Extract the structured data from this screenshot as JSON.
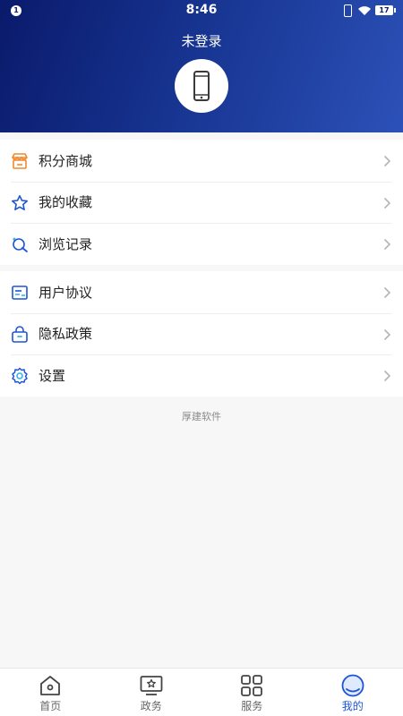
{
  "status_bar": {
    "notification_count": "1",
    "time": "8:46",
    "battery": "17"
  },
  "header": {
    "login_status": "未登录",
    "avatar_icon": "phone-icon"
  },
  "menu_groups": [
    {
      "items": [
        {
          "label": "积分商城",
          "icon": "store-icon",
          "icon_color": "#f08a2e"
        },
        {
          "label": "我的收藏",
          "icon": "star-icon",
          "icon_color": "#1d55d3"
        },
        {
          "label": "浏览记录",
          "icon": "history-icon",
          "icon_color": "#1d55d3"
        }
      ]
    },
    {
      "items": [
        {
          "label": "用户协议",
          "icon": "agreement-icon",
          "icon_color": "#1d55d3"
        },
        {
          "label": "隐私政策",
          "icon": "lock-bag-icon",
          "icon_color": "#1d55d3"
        },
        {
          "label": "设置",
          "icon": "gear-icon",
          "icon_color": "#1d55d3"
        }
      ]
    }
  ],
  "brand_footer": "厚建软件",
  "tabs": [
    {
      "label": "首页",
      "icon": "home-icon",
      "active": false
    },
    {
      "label": "政务",
      "icon": "government-monitor-icon",
      "active": false
    },
    {
      "label": "服务",
      "icon": "grid-icon",
      "active": false
    },
    {
      "label": "我的",
      "icon": "profile-circle-icon",
      "active": true
    }
  ],
  "colors": {
    "header_dark": "#0a1a6b",
    "header_light": "#2c51b8",
    "accent": "#1d55d3",
    "background": "#f7f7f7"
  }
}
